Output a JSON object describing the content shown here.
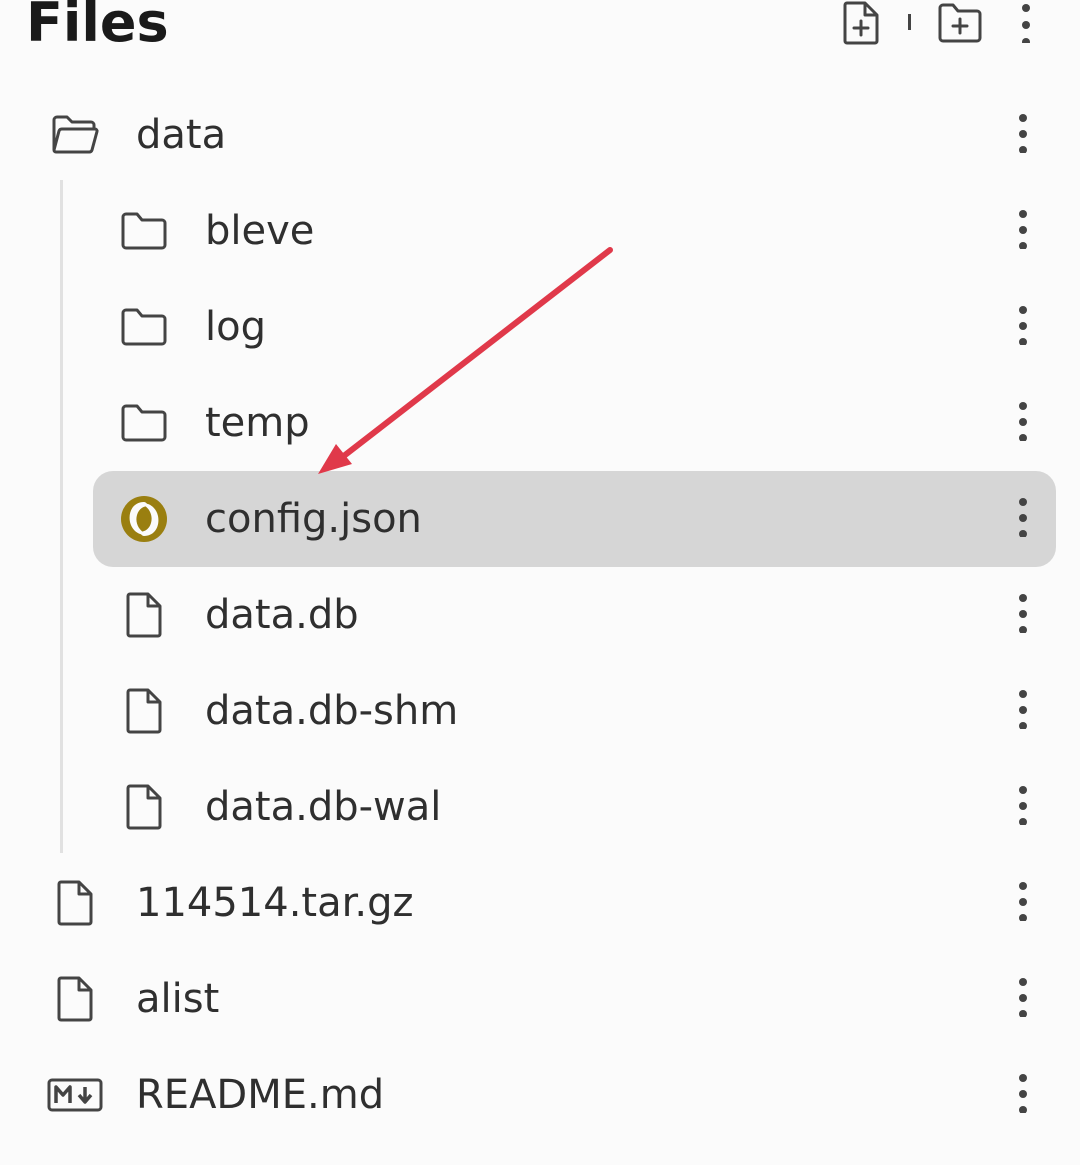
{
  "header": {
    "title": "Files",
    "new_file_icon": "file-plus-icon",
    "new_folder_icon": "folder-plus-icon",
    "menu_icon": "more-vertical-icon"
  },
  "tree": {
    "items": [
      {
        "name": "data",
        "icon": "folder-open-icon",
        "depth": 0,
        "selected": false
      },
      {
        "name": "bleve",
        "icon": "folder-icon",
        "depth": 1,
        "selected": false
      },
      {
        "name": "log",
        "icon": "folder-icon",
        "depth": 1,
        "selected": false
      },
      {
        "name": "temp",
        "icon": "folder-icon",
        "depth": 1,
        "selected": false
      },
      {
        "name": "config.json",
        "icon": "json-icon",
        "depth": 1,
        "selected": true
      },
      {
        "name": "data.db",
        "icon": "file-icon",
        "depth": 1,
        "selected": false
      },
      {
        "name": "data.db-shm",
        "icon": "file-icon",
        "depth": 1,
        "selected": false
      },
      {
        "name": "data.db-wal",
        "icon": "file-icon",
        "depth": 1,
        "selected": false
      },
      {
        "name": "114514.tar.gz",
        "icon": "file-icon",
        "depth": 0,
        "selected": false
      },
      {
        "name": "alist",
        "icon": "file-icon",
        "depth": 0,
        "selected": false
      },
      {
        "name": "README.md",
        "icon": "markdown-icon",
        "depth": 0,
        "selected": false
      }
    ]
  },
  "annotation": {
    "type": "arrow",
    "color": "#e0394a",
    "points_to": "config.json"
  },
  "colors": {
    "selected_bg": "#d6d6d6",
    "json_icon": "#9a7f10",
    "text": "#2f2f2f"
  }
}
